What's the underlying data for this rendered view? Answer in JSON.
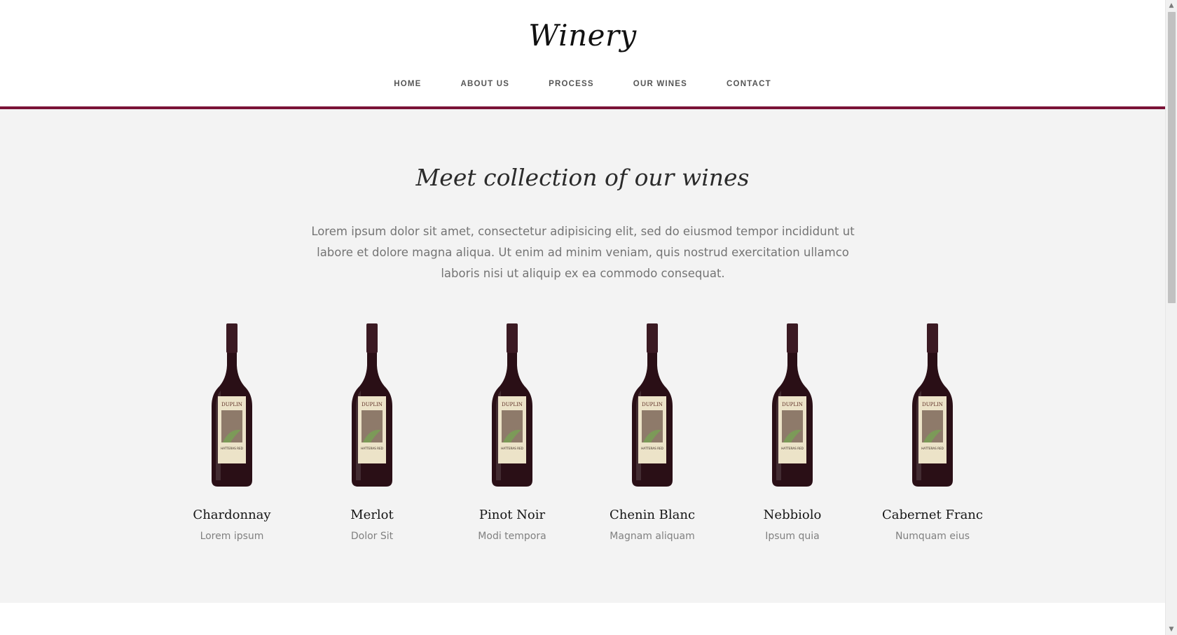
{
  "header": {
    "logo": "Winery",
    "nav": [
      "HOME",
      "ABOUT US",
      "PROCESS",
      "OUR WINES",
      "CONTACT"
    ]
  },
  "collection": {
    "title": "Meet collection of our wines",
    "intro": "Lorem ipsum dolor sit amet, consectetur adipisicing elit, sed do eiusmod tempor incididunt ut labore et dolore magna aliqua. Ut enim ad minim veniam, quis nostrud exercitation ullamco laboris nisi ut aliquip ex ea commodo consequat.",
    "wines": [
      {
        "name": "Chardonnay",
        "subtitle": "Lorem ipsum",
        "label_brand": "DUPLIN",
        "label_text": "HATTERAS RED"
      },
      {
        "name": "Merlot",
        "subtitle": "Dolor Sit",
        "label_brand": "DUPLIN",
        "label_text": "HATTERAS RED"
      },
      {
        "name": "Pinot Noir",
        "subtitle": "Modi tempora",
        "label_brand": "DUPLIN",
        "label_text": "HATTERAS RED"
      },
      {
        "name": "Chenin Blanc",
        "subtitle": "Magnam aliquam",
        "label_brand": "DUPLIN",
        "label_text": "HATTERAS RED"
      },
      {
        "name": "Nebbiolo",
        "subtitle": "Ipsum quia",
        "label_brand": "DUPLIN",
        "label_text": "HATTERAS RED"
      },
      {
        "name": "Cabernet Franc",
        "subtitle": "Numquam eius",
        "label_brand": "DUPLIN",
        "label_text": "HATTERAS RED"
      }
    ]
  },
  "colors": {
    "accent": "#7a1237",
    "section_bg": "#f3f3f3",
    "wine_glass": "#2a0f16",
    "wine_label": "#ece3c8"
  },
  "scrollbar": {
    "up_icon": "scroll-up-arrow-icon",
    "down_icon": "scroll-down-arrow-icon"
  }
}
